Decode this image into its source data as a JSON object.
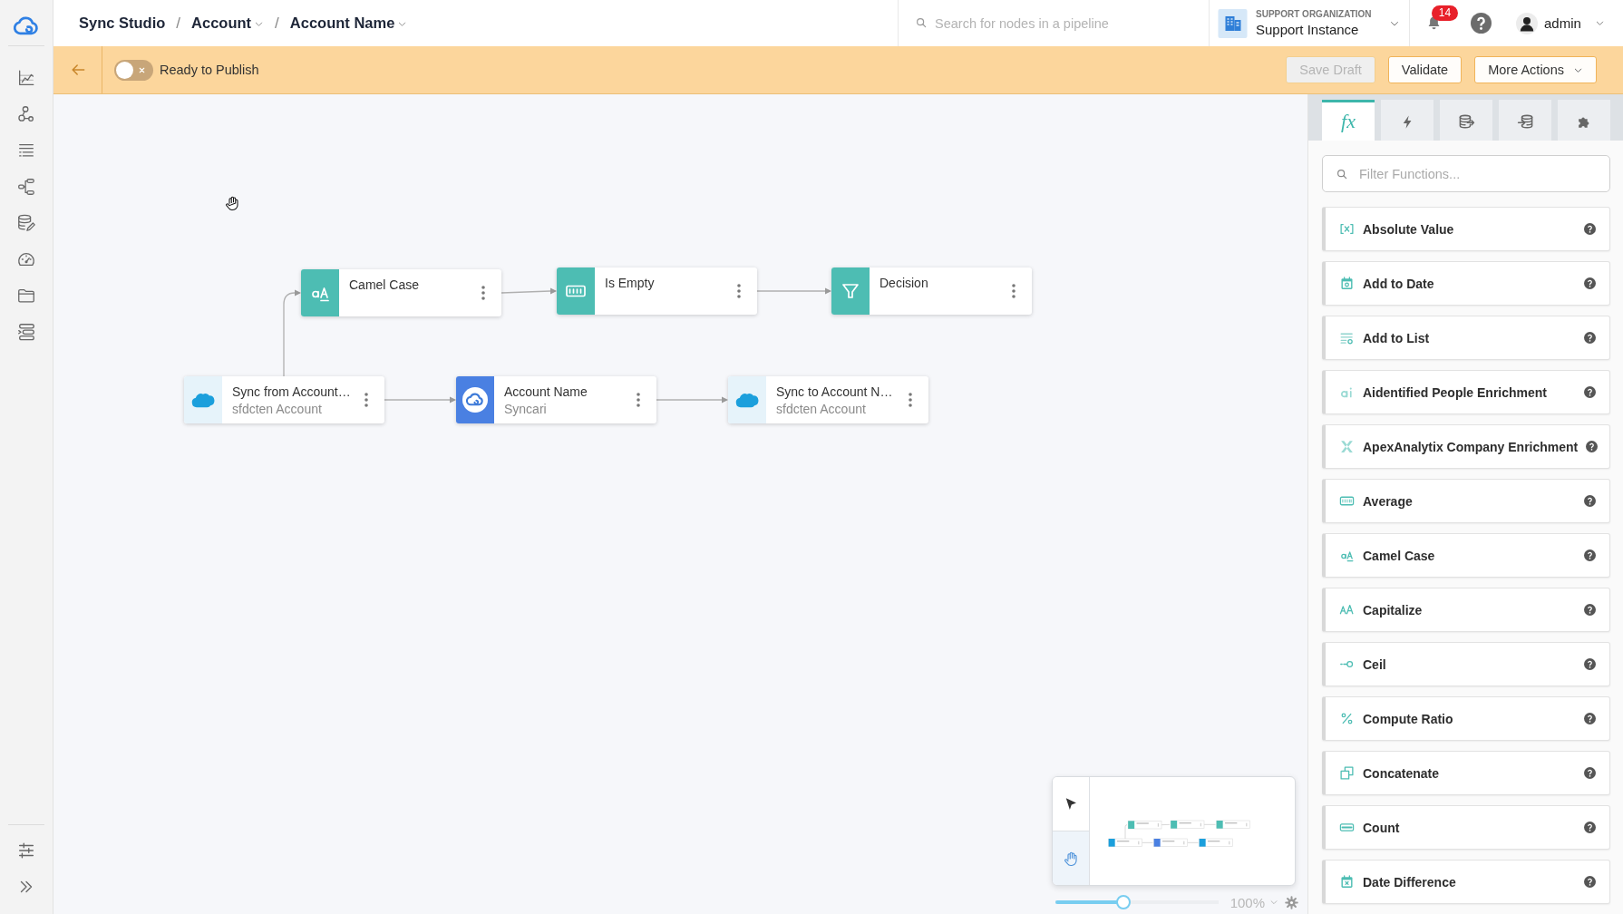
{
  "breadcrumb": [
    {
      "label": "Sync Studio",
      "dropdown": false
    },
    {
      "separator": "/",
      "label": "Account",
      "dropdown": true
    },
    {
      "separator": "/",
      "label": "Account Name",
      "dropdown": true
    }
  ],
  "search": {
    "placeholder": "Search for nodes in a pipeline"
  },
  "organization": {
    "caption": "SUPPORT ORGANIZATION",
    "name": "Support Instance"
  },
  "notifications": {
    "count": "14"
  },
  "user": {
    "name": "admin"
  },
  "toolbar": {
    "publish_toggle": {
      "label": "Ready to Publish",
      "on": false
    },
    "buttons": [
      {
        "label": "Save Draft",
        "disabled": true,
        "dropdown": false
      },
      {
        "label": "Validate",
        "disabled": false,
        "dropdown": false
      },
      {
        "label": "More Actions",
        "disabled": false,
        "dropdown": true
      }
    ]
  },
  "canvas": {
    "nodes": [
      {
        "kind": "function",
        "title": "Camel Case"
      },
      {
        "kind": "function",
        "title": "Is Empty"
      },
      {
        "kind": "function",
        "title": "Decision"
      },
      {
        "kind": "connector",
        "title": "Sync from Account…",
        "subtitle": "sfdcten Account"
      },
      {
        "kind": "entity",
        "title": "Account Name",
        "subtitle": "Syncari"
      },
      {
        "kind": "connector",
        "title": "Sync to Account N…",
        "subtitle": "sfdcten Account"
      }
    ]
  },
  "minimap": {
    "tools": [
      {
        "selected": false
      },
      {
        "selected": true
      }
    ],
    "zoom": {
      "level": 0.42,
      "reading": "100%"
    }
  },
  "functions_panel": {
    "tabs": [
      {
        "label": "fx",
        "selected": true
      },
      {
        "selected": false
      },
      {
        "selected": false
      },
      {
        "selected": false
      },
      {
        "selected": false
      }
    ],
    "filter": {
      "placeholder": "Filter Functions..."
    },
    "items": [
      {
        "label": "Absolute Value"
      },
      {
        "label": "Add to Date"
      },
      {
        "label": "Add to List"
      },
      {
        "label": "Aidentified People Enrichment"
      },
      {
        "label": "ApexAnalytix Company Enrichment"
      },
      {
        "label": "Average"
      },
      {
        "label": "Camel Case"
      },
      {
        "label": "Capitalize"
      },
      {
        "label": "Ceil"
      },
      {
        "label": "Compute Ratio"
      },
      {
        "label": "Concatenate"
      },
      {
        "label": "Count"
      },
      {
        "label": "Date Difference"
      }
    ]
  }
}
